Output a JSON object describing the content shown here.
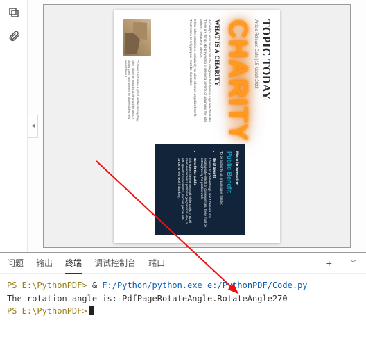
{
  "pdf": {
    "topic_title": "TOPIC TODAY",
    "release": "Article Release Date | 15 March 2022",
    "charity": "CHARITY",
    "subhead": "WHAT IS A CHARITY",
    "body1": "A charity's aims have to fall into categories that the law says are charitable. These are things like preventing or relieving poverty, or advancing the arts, culture, heritage or science.",
    "body2": "It has to be established exclusively for what is known as public benefit. That means its only purpose must be charitable.",
    "info": {
      "more": "More Information",
      "pb": "Public Benefit",
      "lead": "To be a charity, an organisation has to:",
      "b1_t": "Be of benefit",
      "b1_d": "It has to do positive things, and if there are any negative side-effects or consequences, these must be outweighed by the positive work.",
      "b2_t": "Benefit the public",
      "b2_d": "This doesn't have to mean all of the public. It could mean everyone in a particular geographical area, or with specific characteristics, such as people with cancer, or who work in banking."
    },
    "bottom1": "Charities can't make a profit. All the money they raise has to go towards achieving their aims. A charity can't have owners or shareholders who benefit from it."
  },
  "tabs": {
    "problems": "问题",
    "output": "输出",
    "terminal": "终端",
    "debug": "调试控制台",
    "ports": "端口"
  },
  "terminal": {
    "line1_prompt": "PS E:\\PythonPDF>",
    "line1_amp": " & ",
    "line1_exe": "F:/Python/python.exe",
    "line1_script": "/PythonPDF/Code.py",
    "line2": "The rotation angle is: PdfPageRotateAngle.RotateAngle270",
    "line3_prompt": "PS E:\\PythonPDF>"
  }
}
